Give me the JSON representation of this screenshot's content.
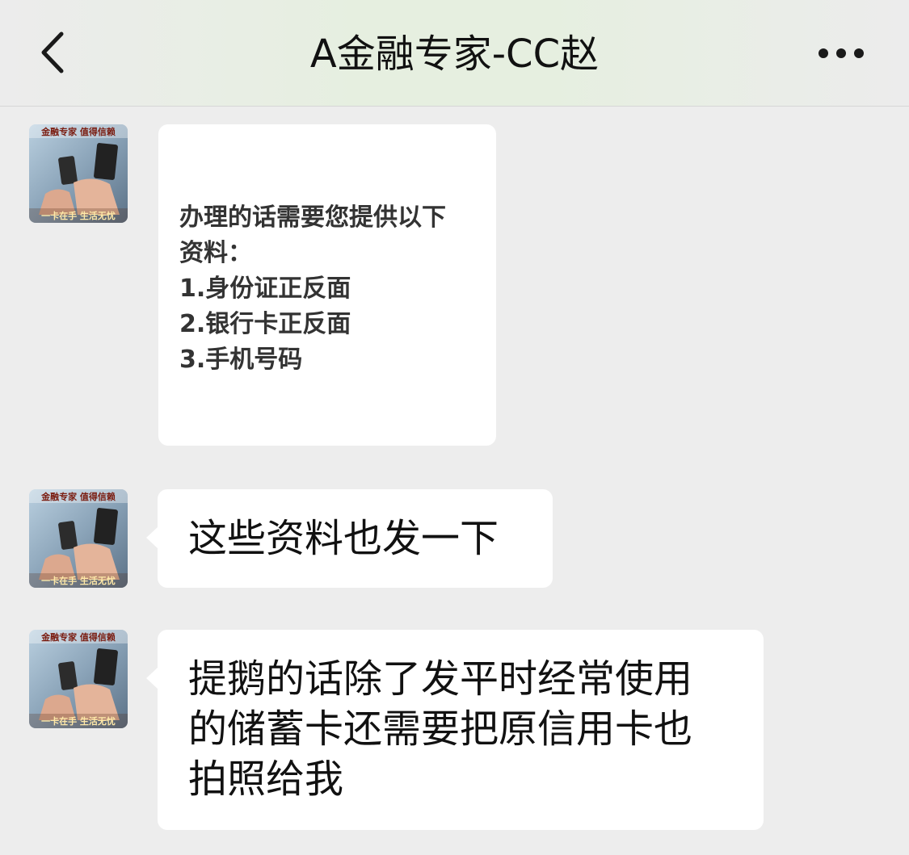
{
  "header": {
    "title": "A金融专家-CC赵",
    "back_icon": "chevron-left-icon",
    "more_icon": "more-horizontal-icon"
  },
  "avatar": {
    "top_text": "金融专家 值得信赖",
    "bottom_text": "一卡在手 生活无忧"
  },
  "messages": [
    {
      "type": "card",
      "text": "办理的话需要您提供以下\n资料：\n1.身份证正反面\n2.银行卡正反面\n3.手机号码"
    },
    {
      "type": "text",
      "text": "这些资料也发一下"
    },
    {
      "type": "text",
      "text": "提鹅的话除了发平时经常使用\n的储蓄卡还需要把原信用卡也\n拍照给我"
    }
  ]
}
